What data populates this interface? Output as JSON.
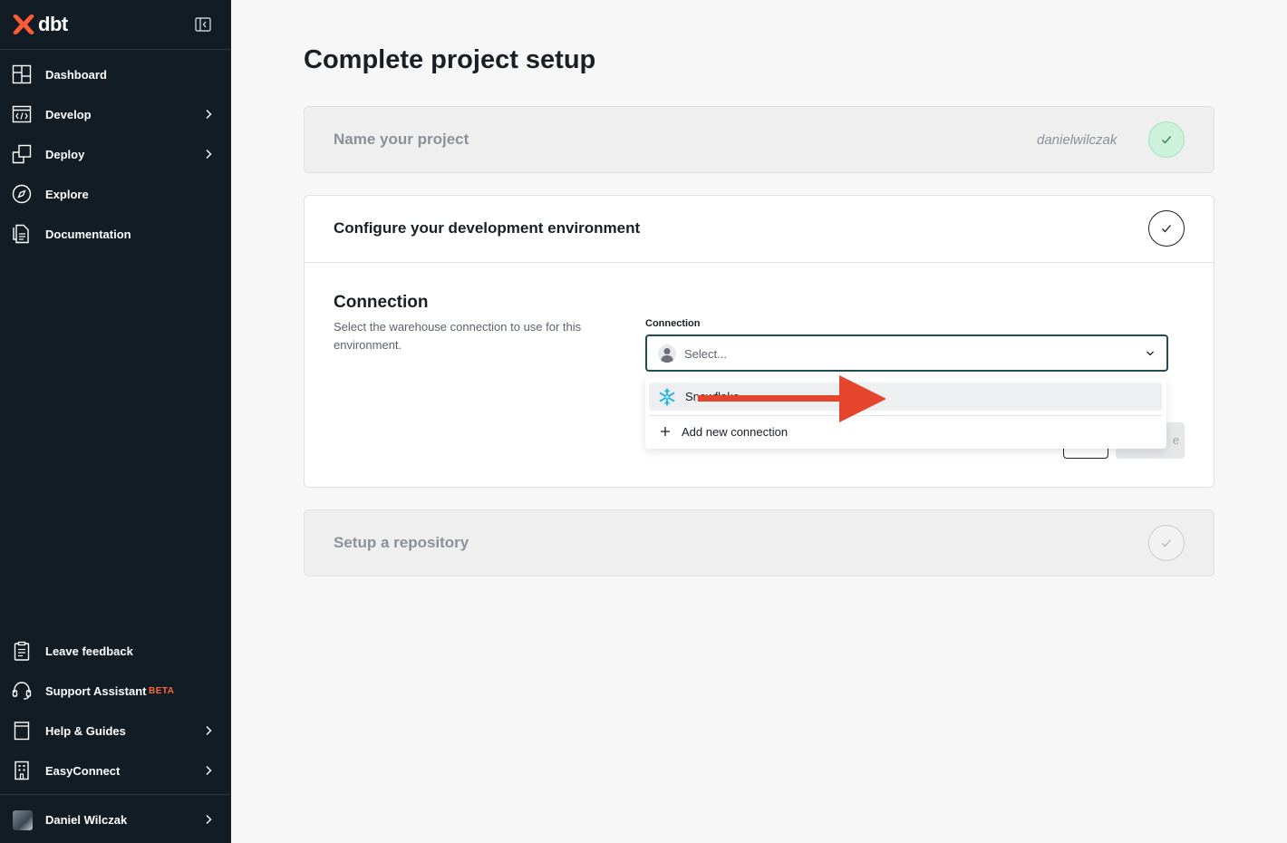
{
  "sidebar": {
    "brand": "dbt",
    "nav": [
      {
        "label": "Dashboard",
        "icon": "dashboard-icon"
      },
      {
        "label": "Develop",
        "icon": "code-window-icon"
      },
      {
        "label": "Deploy",
        "icon": "deploy-icon"
      },
      {
        "label": "Explore",
        "icon": "compass-icon"
      },
      {
        "label": "Documentation",
        "icon": "documents-icon"
      }
    ],
    "bottom": [
      {
        "label": "Leave feedback",
        "icon": "clipboard-icon"
      },
      {
        "label": "Support Assistant",
        "icon": "headset-icon",
        "badge": "BETA"
      },
      {
        "label": "Help & Guides",
        "icon": "book-icon"
      },
      {
        "label": "EasyConnect",
        "icon": "building-icon"
      }
    ],
    "user": "Daniel Wilczak"
  },
  "main": {
    "title": "Complete project setup",
    "step1": {
      "title": "Name your project",
      "value": "danielwilczak",
      "status": "complete"
    },
    "step2": {
      "title": "Configure your development environment",
      "section_title": "Connection",
      "section_desc": "Select the warehouse connection to use for this environment.",
      "field_label": "Connection",
      "placeholder": "Select...",
      "options": [
        {
          "label": "Snowflake",
          "icon": "snowflake-icon"
        },
        {
          "label": "Add new connection",
          "icon": "plus-icon"
        }
      ],
      "hidden_button_tail": "e"
    },
    "step3": {
      "title": "Setup a repository",
      "status": "pending"
    }
  },
  "colors": {
    "sidebar_bg": "#111c24",
    "accent": "#ff6a3d",
    "arrow": "#e5452c",
    "success": "#cdf2dc"
  }
}
